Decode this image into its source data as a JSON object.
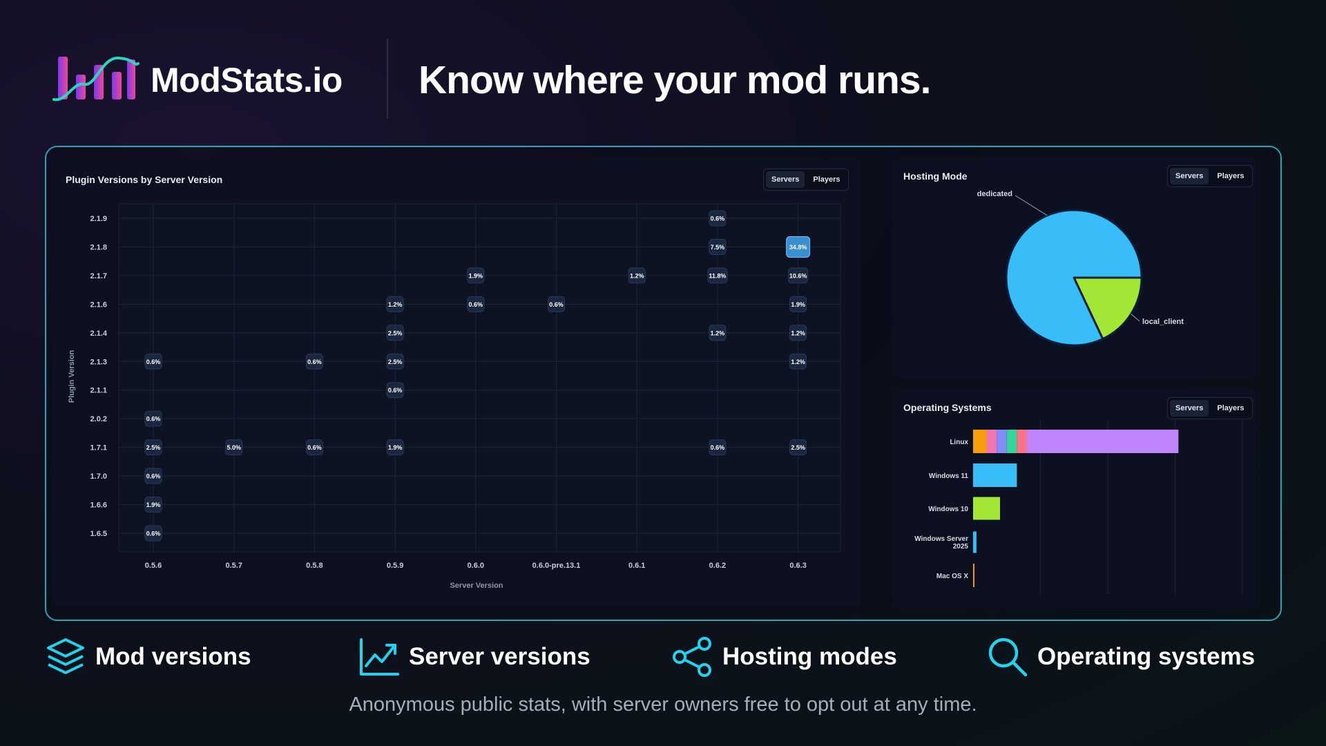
{
  "header": {
    "brand": "ModStats.io",
    "tagline": "Know where your mod runs."
  },
  "scatter_panel": {
    "title": "Plugin Versions by Server Version",
    "toggle": [
      "Servers",
      "Players"
    ],
    "toggle_active": "Servers"
  },
  "hosting_panel": {
    "title": "Hosting Mode",
    "toggle": [
      "Servers",
      "Players"
    ],
    "toggle_active": "Servers"
  },
  "os_panel": {
    "title": "Operating Systems",
    "toggle": [
      "Servers",
      "Players"
    ],
    "toggle_active": "Servers"
  },
  "features": [
    {
      "label": "Mod versions",
      "icon": "layers-icon"
    },
    {
      "label": "Server versions",
      "icon": "trend-chart-icon"
    },
    {
      "label": "Hosting modes",
      "icon": "share-icon"
    },
    {
      "label": "Operating systems",
      "icon": "search-icon"
    }
  ],
  "footer": "Anonymous public stats, with server owners free to opt out at any time.",
  "colors": {
    "accent": "#2aa3b4",
    "bubble": "#1b2740",
    "bubble_highlight": "#3a8fd0",
    "pie_dedicated": "#38bdf8",
    "pie_local": "#a3e635",
    "logo_gradient": [
      "#7c3aed",
      "#ec4899"
    ]
  },
  "chart_data": [
    {
      "type": "heatmap",
      "title": "Plugin Versions by Server Version",
      "xlabel": "Server Version",
      "ylabel": "Plugin Version",
      "x_categories": [
        "0.5.6",
        "0.5.7",
        "0.5.8",
        "0.5.9",
        "0.6.0",
        "0.6.0-pre.13.1",
        "0.6.1",
        "0.6.2",
        "0.6.3"
      ],
      "y_categories": [
        "2.1.9",
        "2.1.8",
        "2.1.7",
        "2.1.6",
        "2.1.4",
        "2.1.3",
        "2.1.1",
        "2.0.2",
        "1.7.1",
        "1.7.0",
        "1.6.6",
        "1.6.5"
      ],
      "cells": [
        {
          "x": "0.6.2",
          "y": "2.1.9",
          "label": "0.6%",
          "value": 0.6
        },
        {
          "x": "0.6.2",
          "y": "2.1.8",
          "label": "7.5%",
          "value": 7.5
        },
        {
          "x": "0.6.3",
          "y": "2.1.8",
          "label": "34.8%",
          "value": 34.8
        },
        {
          "x": "0.6.0",
          "y": "2.1.7",
          "label": "1.9%",
          "value": 1.9
        },
        {
          "x": "0.6.1",
          "y": "2.1.7",
          "label": "1.2%",
          "value": 1.2
        },
        {
          "x": "0.6.2",
          "y": "2.1.7",
          "label": "11.8%",
          "value": 11.8
        },
        {
          "x": "0.6.3",
          "y": "2.1.7",
          "label": "10.6%",
          "value": 10.6
        },
        {
          "x": "0.5.9",
          "y": "2.1.6",
          "label": "1.2%",
          "value": 1.2
        },
        {
          "x": "0.6.0",
          "y": "2.1.6",
          "label": "0.6%",
          "value": 0.6
        },
        {
          "x": "0.6.0-pre.13.1",
          "y": "2.1.6",
          "label": "0.6%",
          "value": 0.6
        },
        {
          "x": "0.6.3",
          "y": "2.1.6",
          "label": "1.9%",
          "value": 1.9
        },
        {
          "x": "0.5.9",
          "y": "2.1.4",
          "label": "2.5%",
          "value": 2.5
        },
        {
          "x": "0.6.2",
          "y": "2.1.4",
          "label": "1.2%",
          "value": 1.2
        },
        {
          "x": "0.6.3",
          "y": "2.1.4",
          "label": "1.2%",
          "value": 1.2
        },
        {
          "x": "0.5.6",
          "y": "2.1.3",
          "label": "0.6%",
          "value": 0.6
        },
        {
          "x": "0.5.8",
          "y": "2.1.3",
          "label": "0.6%",
          "value": 0.6
        },
        {
          "x": "0.5.9",
          "y": "2.1.3",
          "label": "2.5%",
          "value": 2.5
        },
        {
          "x": "0.6.3",
          "y": "2.1.3",
          "label": "1.2%",
          "value": 1.2
        },
        {
          "x": "0.5.9",
          "y": "2.1.1",
          "label": "0.6%",
          "value": 0.6
        },
        {
          "x": "0.5.6",
          "y": "2.0.2",
          "label": "0.6%",
          "value": 0.6
        },
        {
          "x": "0.5.6",
          "y": "1.7.1",
          "label": "2.5%",
          "value": 2.5
        },
        {
          "x": "0.5.7",
          "y": "1.7.1",
          "label": "5.0%",
          "value": 5.0
        },
        {
          "x": "0.5.8",
          "y": "1.7.1",
          "label": "0.6%",
          "value": 0.6
        },
        {
          "x": "0.5.9",
          "y": "1.7.1",
          "label": "1.9%",
          "value": 1.9
        },
        {
          "x": "0.6.2",
          "y": "1.7.1",
          "label": "0.6%",
          "value": 0.6
        },
        {
          "x": "0.6.3",
          "y": "1.7.1",
          "label": "2.5%",
          "value": 2.5
        },
        {
          "x": "0.5.6",
          "y": "1.7.0",
          "label": "0.6%",
          "value": 0.6
        },
        {
          "x": "0.5.6",
          "y": "1.6.6",
          "label": "1.9%",
          "value": 1.9
        },
        {
          "x": "0.5.6",
          "y": "1.6.5",
          "label": "0.6%",
          "value": 0.6
        }
      ],
      "grid": true
    },
    {
      "type": "pie",
      "title": "Hosting Mode",
      "slices": [
        {
          "label": "dedicated",
          "value": 82,
          "color": "#38bdf8"
        },
        {
          "label": "local_client",
          "value": 18,
          "color": "#a3e635"
        }
      ]
    },
    {
      "type": "bar",
      "orientation": "horizontal",
      "stacked": true,
      "title": "Operating Systems",
      "categories": [
        "Linux",
        "Windows 11",
        "Windows 10",
        "Windows Server 2025",
        "Mac OS X"
      ],
      "xlim": [
        0,
        40
      ],
      "grid": true,
      "series": [
        {
          "color": "#f59e0b",
          "values": [
            2.0,
            0,
            0,
            0,
            0.2
          ]
        },
        {
          "color": "#f472b6",
          "values": [
            1.5,
            0,
            0,
            0,
            0
          ]
        },
        {
          "color": "#818cf8",
          "values": [
            1.5,
            0,
            0,
            0,
            0
          ]
        },
        {
          "color": "#34d399",
          "values": [
            1.5,
            0,
            0,
            0,
            0
          ]
        },
        {
          "color": "#fb7185",
          "values": [
            1.5,
            0,
            0,
            0,
            0
          ]
        },
        {
          "color": "#c084fc",
          "values": [
            22.5,
            0,
            0,
            0,
            0
          ]
        },
        {
          "color": "#38bdf8",
          "values": [
            0,
            6.5,
            0,
            0.5,
            0
          ]
        },
        {
          "color": "#a3e635",
          "values": [
            0,
            0,
            4.0,
            0,
            0
          ]
        }
      ]
    }
  ]
}
